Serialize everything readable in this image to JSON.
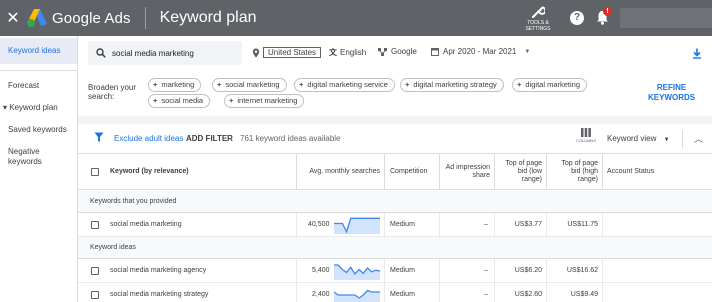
{
  "topbar": {
    "close_glyph": "✕",
    "logo_text": "Google Ads",
    "page_title": "Keyword plan",
    "tools_label_1": "TOOLS &",
    "tools_label_2": "SETTINGS",
    "help_glyph": "?",
    "notification_badge": "!"
  },
  "sidebar": {
    "items": [
      {
        "label": "Keyword ideas",
        "active": true
      },
      {
        "label": "Forecast"
      },
      {
        "label": "▾ Keyword plan"
      },
      {
        "label": "Saved keywords"
      },
      {
        "label": "Negative"
      },
      {
        "label": "keywords"
      }
    ]
  },
  "search": {
    "value": "social media marketing",
    "location": "United States",
    "language": "English",
    "network": "Google",
    "date_range": "Apr 2020 - Mar 2021"
  },
  "broaden": {
    "label_1": "Broaden your",
    "label_2": "search:",
    "chips": [
      "marketing",
      "social marketing",
      "digital marketing service",
      "digital marketing strategy",
      "digital marketing",
      "social media",
      "internet marketing"
    ],
    "refine_1": "REFINE",
    "refine_2": "KEYWORDS"
  },
  "toolbar": {
    "exclude_adult": "Exclude adult ideas",
    "add_filter": "ADD FILTER",
    "count": "761 keyword ideas available",
    "columns_label": "COLUMNS",
    "view": "Keyword view"
  },
  "table": {
    "headers": {
      "keyword": "Keyword (by relevance)",
      "searches": "Avg. monthly searches",
      "competition": "Competition",
      "ad_impression_1": "Ad impression",
      "ad_impression_2": "share",
      "bid_low_1": "Top of page",
      "bid_low_2": "bid (low",
      "bid_low_3": "range)",
      "bid_high_1": "Top of page",
      "bid_high_2": "bid (high",
      "bid_high_3": "range)",
      "status": "Account Status"
    },
    "section_provided": "Keywords that you provided",
    "section_ideas": "Keyword ideas",
    "rows": [
      {
        "keyword": "social media marketing",
        "searches": "40,500",
        "competition": "Medium",
        "share": "–",
        "low": "US$3.77",
        "high": "US$11.75",
        "trend": [
          0.6,
          0.6,
          0.6,
          0.05,
          0.95,
          0.95,
          0.95,
          0.95,
          0.95,
          0.95,
          0.95,
          0.95
        ]
      },
      {
        "keyword": "social media marketing agency",
        "searches": "5,400",
        "competition": "Medium",
        "share": "–",
        "low": "US$6.20",
        "high": "US$16.62",
        "trend": [
          0.9,
          0.9,
          0.6,
          0.4,
          0.75,
          0.3,
          0.6,
          0.35,
          0.7,
          0.45,
          0.55,
          0.5
        ]
      },
      {
        "keyword": "social media marketing strategy",
        "searches": "2,400",
        "competition": "Medium",
        "share": "–",
        "low": "US$2.60",
        "high": "US$9.49",
        "trend": [
          0.7,
          0.5,
          0.5,
          0.5,
          0.5,
          0.5,
          0.3,
          0.5,
          0.8,
          0.7,
          0.7,
          0.7
        ]
      }
    ]
  },
  "colors": {
    "topbar": "#5f6368",
    "accent_blue": "#1a73e8",
    "sparkline": "#4285f4",
    "sparkline_fill": "#d2e3fc",
    "active_nav_bg": "#e8eaf6"
  }
}
